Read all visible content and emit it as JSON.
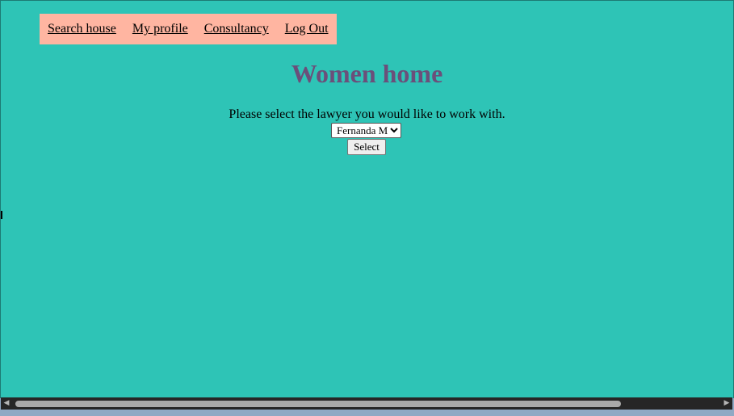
{
  "nav": {
    "items": [
      {
        "label": "Search house"
      },
      {
        "label": "My profile"
      },
      {
        "label": "Consultancy"
      },
      {
        "label": "Log Out"
      }
    ]
  },
  "page": {
    "title": "Women home",
    "prompt": "Please select the lawyer you would like to work with."
  },
  "lawyer_select": {
    "selected": "Fernanda M",
    "options": [
      "Fernanda M"
    ]
  },
  "select_button": {
    "label": "Select"
  },
  "colors": {
    "background": "#2ec4b6",
    "nav_background": "#ffb5a1",
    "title": "#6b4f7a"
  },
  "icons": {
    "scroll_left": "scroll-left-arrow-icon",
    "scroll_right": "scroll-right-arrow-icon"
  }
}
